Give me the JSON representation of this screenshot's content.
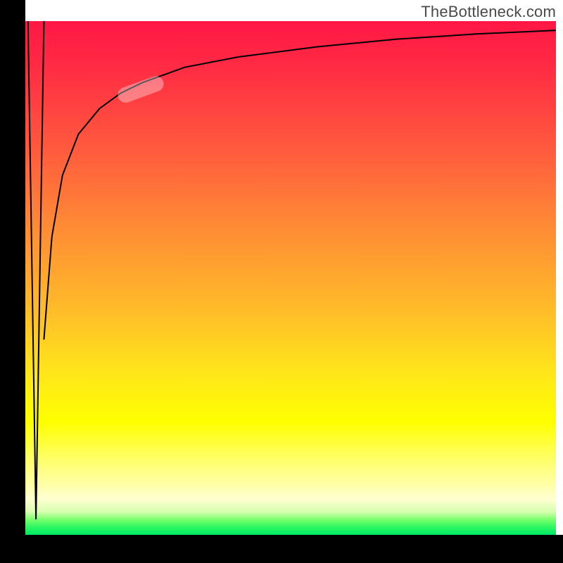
{
  "watermark": "TheBottleneck.com",
  "highlight_pill": {
    "x_start": 14,
    "x_end": 22
  },
  "chart_data": {
    "type": "line",
    "title": "",
    "xlabel": "",
    "ylabel": "",
    "xlim": [
      0,
      100
    ],
    "ylim": [
      0,
      100
    ],
    "grid": false,
    "legend": false,
    "background_gradient": {
      "direction": "vertical",
      "stops": [
        {
          "pos": 0,
          "color": "#ff1745"
        },
        {
          "pos": 0.25,
          "color": "#ff5a3e"
        },
        {
          "pos": 0.55,
          "color": "#ffb82a"
        },
        {
          "pos": 0.78,
          "color": "#ffff00"
        },
        {
          "pos": 0.93,
          "color": "#ffffd0"
        },
        {
          "pos": 1.0,
          "color": "#00e865"
        }
      ]
    },
    "series": [
      {
        "name": "spike",
        "x": [
          0.5,
          2.0,
          3.5
        ],
        "y": [
          100,
          3,
          100
        ],
        "stroke": "#000000",
        "width": 2
      },
      {
        "name": "log-curve",
        "x": [
          3.5,
          5,
          7,
          10,
          14,
          18,
          22,
          30,
          40,
          55,
          70,
          85,
          100
        ],
        "y": [
          38,
          58,
          70,
          78,
          83,
          86,
          88,
          91,
          93,
          95,
          96.5,
          97.5,
          98.2
        ],
        "stroke": "#000000",
        "width": 2
      }
    ]
  }
}
